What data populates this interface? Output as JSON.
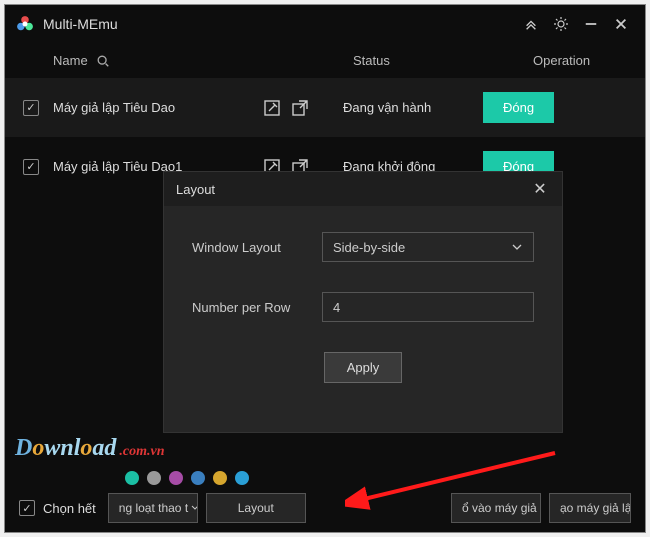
{
  "app": {
    "title": "Multi-MEmu"
  },
  "columns": {
    "name": "Name",
    "status": "Status",
    "operation": "Operation"
  },
  "rows": [
    {
      "checked": true,
      "name": "Máy giả lập Tiêu Dao",
      "status": "Đang vận hành",
      "action": "Đóng"
    },
    {
      "checked": true,
      "name": "Máy giả lập Tiêu Dao1",
      "status": "Đang khởi động",
      "action": "Đóng"
    }
  ],
  "dialog": {
    "title": "Layout",
    "window_layout_label": "Window Layout",
    "window_layout_value": "Side-by-side",
    "num_per_row_label": "Number per Row",
    "num_per_row_value": "4",
    "apply": "Apply"
  },
  "bottom": {
    "select_all": "Chọn hết",
    "batch": "ng loạt thao t",
    "layout": "Layout",
    "clone": "ổ vào máy giả lậ",
    "create": "ạo máy giả lập"
  },
  "dots": [
    "#1bbfa4",
    "#999999",
    "#a64ca6",
    "#3a7fbf",
    "#d6a62e",
    "#2a9fd6"
  ],
  "watermark": {
    "text": "Download",
    "suffix": ".com.vn"
  }
}
